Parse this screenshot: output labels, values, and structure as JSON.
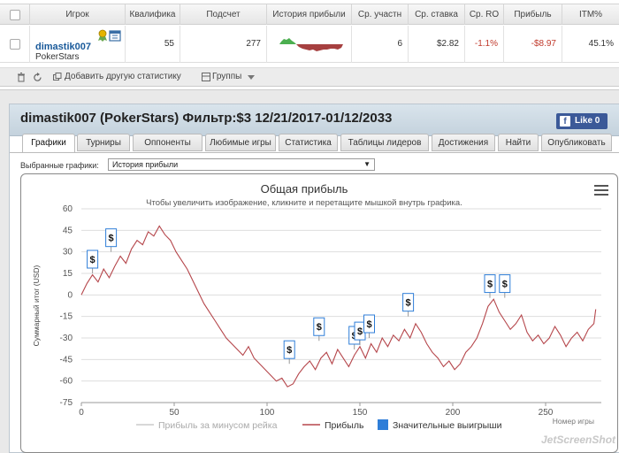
{
  "table": {
    "columns": [
      "Игрок",
      "Квалифика",
      "Подсчет",
      "История прибыли",
      "Ср. участн",
      "Ср. ставка",
      "Ср. RO",
      "Прибыль",
      "ITM%"
    ],
    "row": {
      "name": "dimastik007",
      "site": "PokerStars",
      "qualification": "55",
      "count": "277",
      "avg_entrants": "6",
      "avg_stake": "$2.82",
      "avg_roi": "-1.1%",
      "profit": "-$8.97",
      "itm": "45.1%"
    }
  },
  "toolbar": {
    "add_stats_label": "Добавить другую статистику",
    "groups_label": "Группы"
  },
  "panel": {
    "title": "dimastik007 (PokerStars) Фильтр:$3 12/21/2017-01/12/2033",
    "like_label": "Like 0",
    "tabs": [
      "Графики",
      "Турниры",
      "Оппоненты",
      "Любимые игры",
      "Статистика",
      "Таблицы лидеров",
      "Достижения",
      "Найти",
      "Опубликовать"
    ],
    "selected_label": "Выбранные графики:",
    "selected_value": "История прибыли"
  },
  "chart_data": {
    "type": "line",
    "title": "Общая прибыль",
    "subtitle": "Чтобы увеличить изображение, кликните и перетащите мышкой внутрь графика.",
    "xlabel": "Номер игры",
    "ylabel": "Суммарный итог (USD)",
    "xlim": [
      0,
      280
    ],
    "ylim": [
      -75,
      60
    ],
    "xticks": [
      0,
      50,
      100,
      150,
      200,
      250
    ],
    "yticks": [
      -75,
      -60,
      -45,
      -30,
      -15,
      0,
      15,
      30,
      45,
      60
    ],
    "grid": true,
    "legend_position": "bottom",
    "series": [
      {
        "name": "Прибыль за минусом рейка",
        "color": "#cccccc",
        "x": [],
        "y": []
      },
      {
        "name": "Прибыль",
        "color": "#b5464b",
        "x": [
          0,
          3,
          6,
          9,
          12,
          15,
          18,
          21,
          24,
          27,
          30,
          33,
          36,
          39,
          42,
          45,
          48,
          51,
          54,
          57,
          60,
          63,
          66,
          69,
          72,
          75,
          78,
          81,
          84,
          87,
          90,
          93,
          96,
          99,
          102,
          105,
          108,
          111,
          114,
          117,
          120,
          123,
          126,
          129,
          132,
          135,
          138,
          141,
          144,
          147,
          150,
          153,
          156,
          159,
          162,
          165,
          168,
          171,
          174,
          177,
          180,
          183,
          186,
          189,
          192,
          195,
          198,
          201,
          204,
          207,
          210,
          213,
          216,
          219,
          222,
          225,
          228,
          231,
          234,
          237,
          240,
          243,
          246,
          249,
          252,
          255,
          258,
          261,
          264,
          267,
          270,
          273,
          276,
          277
        ],
        "y": [
          0,
          8,
          14,
          9,
          18,
          12,
          20,
          27,
          22,
          32,
          38,
          35,
          44,
          41,
          48,
          42,
          38,
          30,
          24,
          18,
          10,
          2,
          -6,
          -12,
          -18,
          -24,
          -30,
          -34,
          -38,
          -42,
          -36,
          -44,
          -48,
          -52,
          -56,
          -60,
          -58,
          -64,
          -62,
          -55,
          -50,
          -46,
          -52,
          -44,
          -40,
          -48,
          -38,
          -44,
          -50,
          -42,
          -36,
          -44,
          -34,
          -40,
          -30,
          -36,
          -28,
          -32,
          -24,
          -30,
          -20,
          -26,
          -34,
          -40,
          -44,
          -50,
          -46,
          -52,
          -48,
          -40,
          -36,
          -30,
          -20,
          -8,
          -3,
          -12,
          -18,
          -24,
          -20,
          -14,
          -26,
          -32,
          -28,
          -34,
          -30,
          -22,
          -28,
          -36,
          -30,
          -26,
          -32,
          -24,
          -20,
          -10
        ]
      }
    ],
    "markers": {
      "name": "Значительные выигрыши",
      "color": "#2f7ed8",
      "x": [
        6,
        16,
        112,
        128,
        147,
        150,
        155,
        176,
        220,
        228
      ],
      "y": [
        15,
        30,
        -48,
        -32,
        -38,
        -35,
        -30,
        -15,
        -2,
        -2
      ]
    }
  },
  "watermark": "JetScreenShot"
}
